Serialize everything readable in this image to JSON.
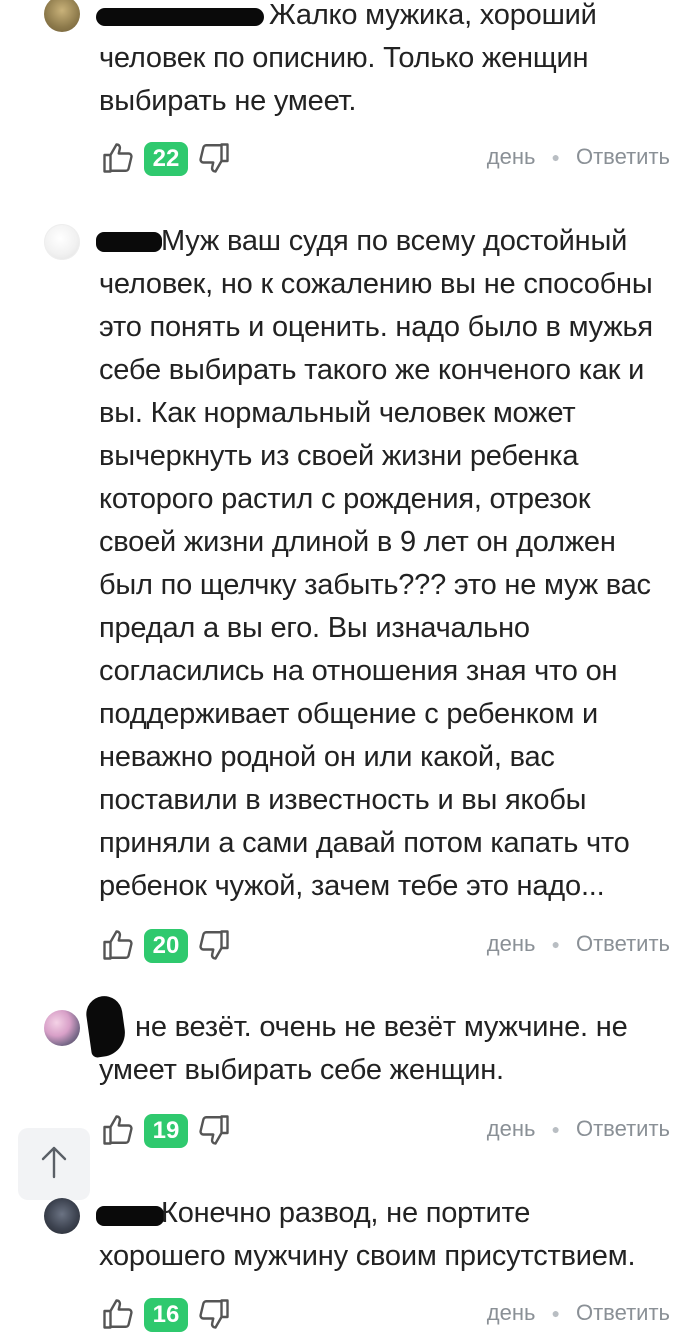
{
  "comments": [
    {
      "text": "Жалко мужика, хороший\nчеловек по описнию. Только женщин\nвыбирать не умеет.",
      "votes": "22",
      "time": "день",
      "reply": "Ответить"
    },
    {
      "text": "Муж ваш судя по всему достойный\nчеловек, но к сожалению вы не способны\nэто понять и оценить. надо было в мужья\nсебе выбирать такого же конченого как и\nвы. Как нормальный человек может\nвычеркнуть из своей жизни ребенка\nкоторого растил с рождения, отрезок\nсвоей жизни длиной в 9 лет он должен\nбыл по щелчку забыть??? это не муж вас\nпредал а вы его. Вы изначально\nсогласились на отношения зная что он\nподдерживает общение с ребенком и\nневажно родной он или какой, вас\nпоставили в известность и вы якобы\nприняли а сами давай потом капать что\nребенок чужой, зачем тебе это надо...",
      "votes": "20",
      "time": "день",
      "reply": "Ответить"
    },
    {
      "text": "не везёт. очень не везёт мужчине. не\nумеет выбирать себе женщин.",
      "votes": "19",
      "time": "день",
      "reply": "Ответить"
    },
    {
      "text": "Конечно развод, не портите\nхорошего мужчину своим присутствием.",
      "votes": "16",
      "time": "день",
      "reply": "Ответить"
    }
  ],
  "icons": {
    "like": "thumbs-up-icon",
    "dislike": "thumbs-down-icon",
    "scroll": "arrow-up-icon"
  },
  "colors": {
    "vote_badge": "#2fc96e",
    "meta_text": "#8a9096"
  }
}
